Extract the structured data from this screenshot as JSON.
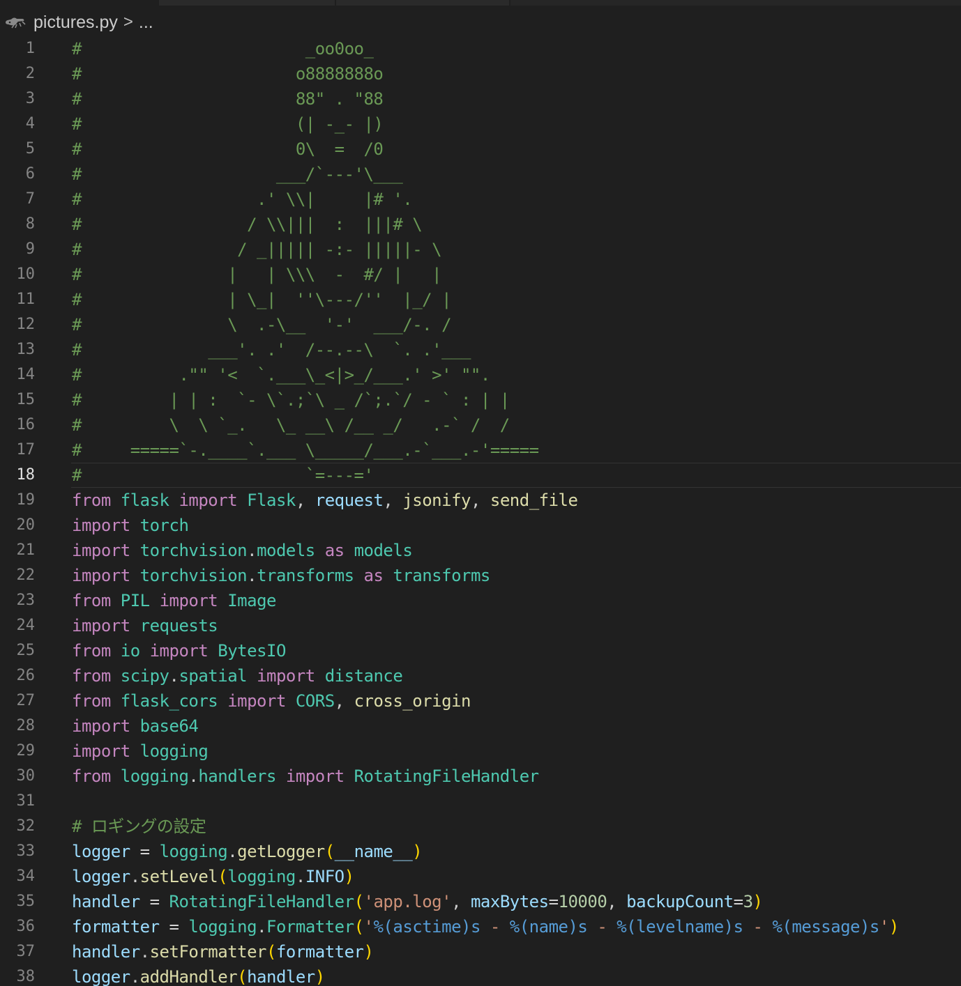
{
  "breadcrumb": {
    "icon": "python-file-icon",
    "filename": "pictures.py",
    "separator": ">",
    "ellipsis": "..."
  },
  "current_line": 18,
  "colors": {
    "background": "#1f1f1f",
    "comment": "#6a9955",
    "keyword": "#c586c0",
    "module": "#4ec9b0",
    "variable": "#9cdcfe",
    "function": "#dcdcaa",
    "string": "#ce9178",
    "number": "#b5cea8",
    "format_spec": "#569cd6",
    "bracket_1": "#ffd700",
    "bracket_2": "#da70d6"
  },
  "lines": [
    [
      {
        "t": "#                       _oo0oo_",
        "c": "c"
      }
    ],
    [
      {
        "t": "#                      o8888888o",
        "c": "c"
      }
    ],
    [
      {
        "t": "#                      88\" . \"88",
        "c": "c"
      }
    ],
    [
      {
        "t": "#                      (| -_- |)",
        "c": "c"
      }
    ],
    [
      {
        "t": "#                      0\\  =  /0",
        "c": "c"
      }
    ],
    [
      {
        "t": "#                    ___/`---'\\___",
        "c": "c"
      }
    ],
    [
      {
        "t": "#                  .' \\\\|     |# '.",
        "c": "c"
      }
    ],
    [
      {
        "t": "#                 / \\\\|||  :  |||# \\",
        "c": "c"
      }
    ],
    [
      {
        "t": "#                / _||||| -:- |||||- \\",
        "c": "c"
      }
    ],
    [
      {
        "t": "#               |   | \\\\\\  -  #/ |   |",
        "c": "c"
      }
    ],
    [
      {
        "t": "#               | \\_|  ''\\---/''  |_/ |",
        "c": "c"
      }
    ],
    [
      {
        "t": "#               \\  .-\\__  '-'  ___/-. /",
        "c": "c"
      }
    ],
    [
      {
        "t": "#             ___'. .'  /--.--\\  `. .'___",
        "c": "c"
      }
    ],
    [
      {
        "t": "#          .\"\" '<  `.___\\_<|>_/___.' >' \"\".",
        "c": "c"
      }
    ],
    [
      {
        "t": "#         | | :  `- \\`.;`\\ _ /`;.`/ - ` : | |",
        "c": "c"
      }
    ],
    [
      {
        "t": "#         \\  \\ `_.   \\_ __\\ /__ _/   .-` /  /",
        "c": "c"
      }
    ],
    [
      {
        "t": "#     =====`-.____`.___ \\_____/___.-`___.-'=====",
        "c": "c"
      }
    ],
    [
      {
        "t": "#                       `=---='",
        "c": "c"
      }
    ],
    [
      {
        "t": "from",
        "c": "kw"
      },
      {
        "t": " "
      },
      {
        "t": "flask",
        "c": "mod"
      },
      {
        "t": " "
      },
      {
        "t": "import",
        "c": "kw"
      },
      {
        "t": " "
      },
      {
        "t": "Flask",
        "c": "mod"
      },
      {
        "t": ", "
      },
      {
        "t": "request",
        "c": "var"
      },
      {
        "t": ", "
      },
      {
        "t": "jsonify",
        "c": "fn"
      },
      {
        "t": ", "
      },
      {
        "t": "send_file",
        "c": "fn"
      }
    ],
    [
      {
        "t": "import",
        "c": "kw"
      },
      {
        "t": " "
      },
      {
        "t": "torch",
        "c": "mod"
      }
    ],
    [
      {
        "t": "import",
        "c": "kw"
      },
      {
        "t": " "
      },
      {
        "t": "torchvision",
        "c": "mod"
      },
      {
        "t": "."
      },
      {
        "t": "models",
        "c": "mod"
      },
      {
        "t": " "
      },
      {
        "t": "as",
        "c": "kw"
      },
      {
        "t": " "
      },
      {
        "t": "models",
        "c": "mod"
      }
    ],
    [
      {
        "t": "import",
        "c": "kw"
      },
      {
        "t": " "
      },
      {
        "t": "torchvision",
        "c": "mod"
      },
      {
        "t": "."
      },
      {
        "t": "transforms",
        "c": "mod"
      },
      {
        "t": " "
      },
      {
        "t": "as",
        "c": "kw"
      },
      {
        "t": " "
      },
      {
        "t": "transforms",
        "c": "mod"
      }
    ],
    [
      {
        "t": "from",
        "c": "kw"
      },
      {
        "t": " "
      },
      {
        "t": "PIL",
        "c": "mod"
      },
      {
        "t": " "
      },
      {
        "t": "import",
        "c": "kw"
      },
      {
        "t": " "
      },
      {
        "t": "Image",
        "c": "mod"
      }
    ],
    [
      {
        "t": "import",
        "c": "kw"
      },
      {
        "t": " "
      },
      {
        "t": "requests",
        "c": "mod"
      }
    ],
    [
      {
        "t": "from",
        "c": "kw"
      },
      {
        "t": " "
      },
      {
        "t": "io",
        "c": "mod"
      },
      {
        "t": " "
      },
      {
        "t": "import",
        "c": "kw"
      },
      {
        "t": " "
      },
      {
        "t": "BytesIO",
        "c": "mod"
      }
    ],
    [
      {
        "t": "from",
        "c": "kw"
      },
      {
        "t": " "
      },
      {
        "t": "scipy",
        "c": "mod"
      },
      {
        "t": "."
      },
      {
        "t": "spatial",
        "c": "mod"
      },
      {
        "t": " "
      },
      {
        "t": "import",
        "c": "kw"
      },
      {
        "t": " "
      },
      {
        "t": "distance",
        "c": "mod"
      }
    ],
    [
      {
        "t": "from",
        "c": "kw"
      },
      {
        "t": " "
      },
      {
        "t": "flask_cors",
        "c": "mod"
      },
      {
        "t": " "
      },
      {
        "t": "import",
        "c": "kw"
      },
      {
        "t": " "
      },
      {
        "t": "CORS",
        "c": "mod"
      },
      {
        "t": ", "
      },
      {
        "t": "cross_origin",
        "c": "fn"
      }
    ],
    [
      {
        "t": "import",
        "c": "kw"
      },
      {
        "t": " "
      },
      {
        "t": "base64",
        "c": "mod"
      }
    ],
    [
      {
        "t": "import",
        "c": "kw"
      },
      {
        "t": " "
      },
      {
        "t": "logging",
        "c": "mod"
      }
    ],
    [
      {
        "t": "from",
        "c": "kw"
      },
      {
        "t": " "
      },
      {
        "t": "logging",
        "c": "mod"
      },
      {
        "t": "."
      },
      {
        "t": "handlers",
        "c": "mod"
      },
      {
        "t": " "
      },
      {
        "t": "import",
        "c": "kw"
      },
      {
        "t": " "
      },
      {
        "t": "RotatingFileHandler",
        "c": "mod"
      }
    ],
    [],
    [
      {
        "t": "# ロギングの設定",
        "c": "c"
      }
    ],
    [
      {
        "t": "logger",
        "c": "var"
      },
      {
        "t": " = ",
        "c": "op"
      },
      {
        "t": "logging",
        "c": "mod"
      },
      {
        "t": "."
      },
      {
        "t": "getLogger",
        "c": "fn"
      },
      {
        "t": "(",
        "c": "p1"
      },
      {
        "t": "__name__",
        "c": "var"
      },
      {
        "t": ")",
        "c": "p1"
      }
    ],
    [
      {
        "t": "logger",
        "c": "var"
      },
      {
        "t": "."
      },
      {
        "t": "setLevel",
        "c": "fn"
      },
      {
        "t": "(",
        "c": "p1"
      },
      {
        "t": "logging",
        "c": "mod"
      },
      {
        "t": "."
      },
      {
        "t": "INFO",
        "c": "var"
      },
      {
        "t": ")",
        "c": "p1"
      }
    ],
    [
      {
        "t": "handler",
        "c": "var"
      },
      {
        "t": " = ",
        "c": "op"
      },
      {
        "t": "RotatingFileHandler",
        "c": "mod"
      },
      {
        "t": "(",
        "c": "p1"
      },
      {
        "t": "'app.log'",
        "c": "str"
      },
      {
        "t": ", "
      },
      {
        "t": "maxBytes",
        "c": "var"
      },
      {
        "t": "=",
        "c": "op"
      },
      {
        "t": "10000",
        "c": "num"
      },
      {
        "t": ", "
      },
      {
        "t": "backupCount",
        "c": "var"
      },
      {
        "t": "=",
        "c": "op"
      },
      {
        "t": "3",
        "c": "num"
      },
      {
        "t": ")",
        "c": "p1"
      }
    ],
    [
      {
        "t": "formatter",
        "c": "var"
      },
      {
        "t": " = ",
        "c": "op"
      },
      {
        "t": "logging",
        "c": "mod"
      },
      {
        "t": "."
      },
      {
        "t": "Formatter",
        "c": "mod"
      },
      {
        "t": "(",
        "c": "p1"
      },
      {
        "t": "'",
        "c": "str"
      },
      {
        "t": "%(asctime)s",
        "c": "fmt"
      },
      {
        "t": " - ",
        "c": "str"
      },
      {
        "t": "%(name)s",
        "c": "fmt"
      },
      {
        "t": " - ",
        "c": "str"
      },
      {
        "t": "%(levelname)s",
        "c": "fmt"
      },
      {
        "t": " - ",
        "c": "str"
      },
      {
        "t": "%(message)s",
        "c": "fmt"
      },
      {
        "t": "'",
        "c": "str"
      },
      {
        "t": ")",
        "c": "p1"
      }
    ],
    [
      {
        "t": "handler",
        "c": "var"
      },
      {
        "t": "."
      },
      {
        "t": "setFormatter",
        "c": "fn"
      },
      {
        "t": "(",
        "c": "p1"
      },
      {
        "t": "formatter",
        "c": "var"
      },
      {
        "t": ")",
        "c": "p1"
      }
    ],
    [
      {
        "t": "logger",
        "c": "var"
      },
      {
        "t": "."
      },
      {
        "t": "addHandler",
        "c": "fn"
      },
      {
        "t": "(",
        "c": "p1"
      },
      {
        "t": "handler",
        "c": "var"
      },
      {
        "t": ")",
        "c": "p1"
      }
    ]
  ]
}
